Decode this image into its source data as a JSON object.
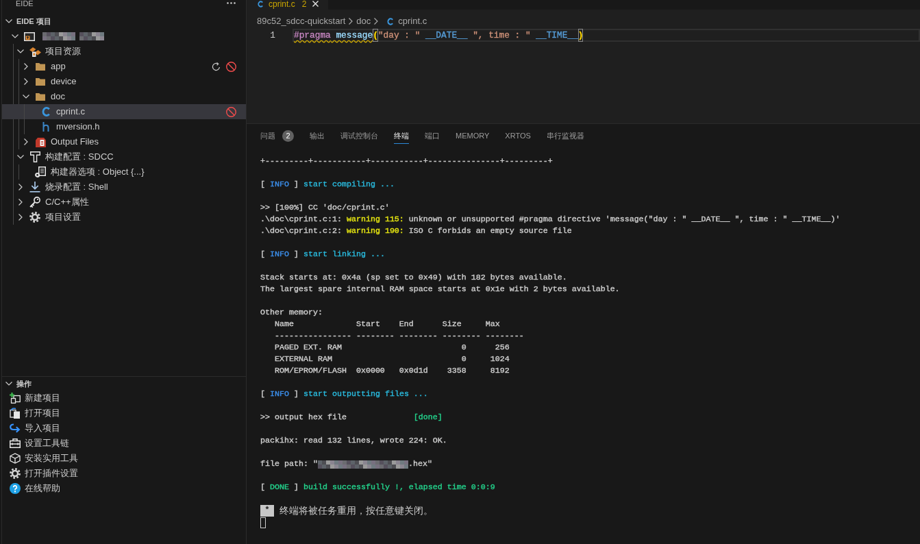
{
  "sidebar": {
    "header": {
      "title": "EIDE"
    },
    "project_section": {
      "title": "EIDE 项目",
      "expanded": true,
      "tree": [
        {
          "kind": "project",
          "redacted": true,
          "expanded": true,
          "selected": false,
          "children": [
            {
              "kind": "sources",
              "label": "项目资源",
              "expanded": true,
              "selected": false,
              "children": [
                {
                  "kind": "folder",
                  "label": "app",
                  "expanded": false,
                  "selected": false,
                  "actions": [
                    {
                      "kind": "refresh"
                    },
                    {
                      "kind": "exclude"
                    }
                  ]
                },
                {
                  "kind": "folder",
                  "label": "device",
                  "expanded": false,
                  "selected": false
                },
                {
                  "kind": "folder",
                  "label": "doc",
                  "expanded": true,
                  "selected": false,
                  "children": [
                    {
                      "kind": "c-file",
                      "label": "cprint.c",
                      "selected": true,
                      "actions": [
                        {
                          "kind": "exclude"
                        }
                      ]
                    },
                    {
                      "kind": "h-file",
                      "label": "mversion.h",
                      "selected": false
                    }
                  ]
                },
                {
                  "kind": "output",
                  "label": "Output Files",
                  "expanded": false,
                  "selected": false
                }
              ]
            },
            {
              "kind": "build",
              "label": "构建配置 : SDCC",
              "expanded": true,
              "selected": false,
              "children": [
                {
                  "kind": "builder-options",
                  "label": "构建器选项 : Object {...}",
                  "selected": false
                }
              ]
            },
            {
              "kind": "flash",
              "label": "烧录配置 : Shell",
              "expanded": false,
              "selected": false
            },
            {
              "kind": "properties",
              "label": "C/C++属性",
              "expanded": false,
              "selected": false
            },
            {
              "kind": "settings",
              "label": "项目设置",
              "expanded": false,
              "selected": false
            }
          ]
        }
      ]
    },
    "operations": {
      "title": "操作",
      "expanded": true,
      "items": [
        {
          "kind": "new-project",
          "label": "新建项目"
        },
        {
          "kind": "open-project",
          "label": "打开项目"
        },
        {
          "kind": "import-project",
          "label": "导入项目"
        },
        {
          "kind": "toolchain",
          "label": "设置工具链"
        },
        {
          "kind": "utility",
          "label": "安装实用工具"
        },
        {
          "kind": "plugin-settings",
          "label": "打开插件设置"
        },
        {
          "kind": "help",
          "label": "在线帮助"
        }
      ]
    }
  },
  "editor": {
    "tabs": [
      {
        "kind": "c-file",
        "label": "cprint.c",
        "problems": "2",
        "selected": true
      }
    ],
    "breadcrumb": [
      {
        "kind": "folder",
        "label": "89c52_sdcc-quickstart"
      },
      {
        "kind": "folder",
        "label": "doc"
      },
      {
        "kind": "c-file",
        "label": "cprint.c"
      }
    ],
    "lines": [
      {
        "number": "1",
        "current": true,
        "tokens": [
          {
            "text": "#pragma",
            "color": "#c586c0",
            "squiggle": true,
            "matched": false
          },
          {
            "text": " message",
            "color": "#9cdcfe",
            "squiggle": true,
            "matched": false
          },
          {
            "text": "(",
            "color": "#ffd700",
            "squiggle": false,
            "matched": true
          },
          {
            "text": "\"day : \"",
            "color": "#ce9178",
            "squiggle": false,
            "matched": false
          },
          {
            "text": " __DATE__ ",
            "color": "#569cd6",
            "squiggle": false,
            "matched": false
          },
          {
            "text": "\", time : \"",
            "color": "#ce9178",
            "squiggle": false,
            "matched": false
          },
          {
            "text": " __TIME__",
            "color": "#569cd6",
            "squiggle": false,
            "matched": false
          },
          {
            "text": ")",
            "color": "#ffd700",
            "squiggle": false,
            "matched": true
          }
        ]
      }
    ]
  },
  "panel": {
    "tabs": [
      {
        "label": "问题",
        "badge": "2",
        "selected": false
      },
      {
        "label": "输出",
        "selected": false
      },
      {
        "label": "调试控制台",
        "selected": false
      },
      {
        "label": "终端",
        "selected": true
      },
      {
        "label": "端口",
        "selected": false
      },
      {
        "label": "MEMORY",
        "selected": false
      },
      {
        "label": "XRTOS",
        "selected": false
      },
      {
        "label": "串行监视器",
        "selected": false
      }
    ],
    "terminal": {
      "blocks": [
        [
          {
            "kind": "output",
            "segments": [
              {
                "kind": "text",
                "text": "+---------+-----------+-----------+---------------+---------+",
                "color": "#cccccc"
              }
            ]
          }
        ],
        [
          {
            "kind": "output",
            "segments": [
              {
                "kind": "text",
                "text": "[ ",
                "color": "#cccccc"
              },
              {
                "kind": "text",
                "text": "INFO",
                "color": "#3b8eea"
              },
              {
                "kind": "text",
                "text": " ] ",
                "color": "#cccccc"
              },
              {
                "kind": "text",
                "text": "start compiling ...",
                "color": "#29b8db"
              }
            ]
          }
        ],
        [
          {
            "kind": "output",
            "segments": [
              {
                "kind": "text",
                "text": ">> [100%] CC 'doc/cprint.c'",
                "color": "#cccccc"
              }
            ]
          },
          {
            "kind": "output",
            "segments": [
              {
                "kind": "text",
                "text": ".\\doc\\cprint.c:1: ",
                "color": "#cccccc"
              },
              {
                "kind": "text",
                "text": "warning 115:",
                "color": "#e5e510"
              },
              {
                "kind": "text",
                "text": " unknown or unsupported #pragma directive 'message(\"day : \" __DATE__ \", time : \" __TIME__)'",
                "color": "#cccccc"
              }
            ]
          },
          {
            "kind": "output",
            "segments": [
              {
                "kind": "text",
                "text": ".\\doc\\cprint.c:2: ",
                "color": "#cccccc"
              },
              {
                "kind": "text",
                "text": "warning 190:",
                "color": "#e5e510"
              },
              {
                "kind": "text",
                "text": " ISO C forbids an empty source file",
                "color": "#cccccc"
              }
            ]
          }
        ],
        [
          {
            "kind": "output",
            "segments": [
              {
                "kind": "text",
                "text": "[ ",
                "color": "#cccccc"
              },
              {
                "kind": "text",
                "text": "INFO",
                "color": "#3b8eea"
              },
              {
                "kind": "text",
                "text": " ] ",
                "color": "#cccccc"
              },
              {
                "kind": "text",
                "text": "start linking ...",
                "color": "#29b8db"
              }
            ]
          }
        ],
        [
          {
            "kind": "output",
            "segments": [
              {
                "kind": "text",
                "text": "Stack starts at: 0x4a (sp set to 0x49) with 182 bytes available.",
                "color": "#cccccc"
              }
            ]
          },
          {
            "kind": "output",
            "segments": [
              {
                "kind": "text",
                "text": "The largest spare internal RAM space starts at 0x1e with 2 bytes available.",
                "color": "#cccccc"
              }
            ]
          }
        ],
        [
          {
            "kind": "output",
            "segments": [
              {
                "kind": "text",
                "text": "Other memory:",
                "color": "#cccccc"
              }
            ]
          },
          {
            "kind": "output",
            "segments": [
              {
                "kind": "text",
                "text": "   Name             Start    End      Size     Max",
                "color": "#cccccc"
              }
            ]
          },
          {
            "kind": "output",
            "segments": [
              {
                "kind": "text",
                "text": "   ---------------- -------- -------- -------- --------",
                "color": "#cccccc"
              }
            ]
          },
          {
            "kind": "output",
            "segments": [
              {
                "kind": "text",
                "text": "   PAGED EXT. RAM                         0      256",
                "color": "#cccccc"
              }
            ]
          },
          {
            "kind": "output",
            "segments": [
              {
                "kind": "text",
                "text": "   EXTERNAL RAM                           0     1024",
                "color": "#cccccc"
              }
            ]
          },
          {
            "kind": "output",
            "segments": [
              {
                "kind": "text",
                "text": "   ROM/EPROM/FLASH  0x0000   0x0d1d    3358     8192",
                "color": "#cccccc"
              }
            ]
          }
        ],
        [
          {
            "kind": "output",
            "segments": [
              {
                "kind": "text",
                "text": "[ ",
                "color": "#cccccc"
              },
              {
                "kind": "text",
                "text": "INFO",
                "color": "#3b8eea"
              },
              {
                "kind": "text",
                "text": " ] ",
                "color": "#cccccc"
              },
              {
                "kind": "text",
                "text": "start outputting files ...",
                "color": "#29b8db"
              }
            ]
          }
        ],
        [
          {
            "kind": "output",
            "segments": [
              {
                "kind": "text",
                "text": ">> output hex file              ",
                "color": "#cccccc"
              },
              {
                "kind": "text",
                "text": "[done]",
                "color": "#23d18b"
              }
            ]
          }
        ],
        [
          {
            "kind": "output",
            "segments": [
              {
                "kind": "text",
                "text": "packihx: read 132 lines, wrote 224: OK.",
                "color": "#cccccc"
              }
            ]
          }
        ],
        [
          {
            "kind": "output",
            "segments": [
              {
                "kind": "text",
                "text": "file path: \"",
                "color": "#cccccc"
              },
              {
                "kind": "redacted"
              },
              {
                "kind": "text",
                "text": ".hex\"",
                "color": "#cccccc"
              }
            ]
          }
        ],
        [
          {
            "kind": "output",
            "segments": [
              {
                "kind": "text",
                "text": "[ ",
                "color": "#cccccc"
              },
              {
                "kind": "text",
                "text": "DONE",
                "color": "#23d18b"
              },
              {
                "kind": "text",
                "text": " ] ",
                "color": "#cccccc"
              },
              {
                "kind": "text",
                "text": "build successfully !, elapsed time 0:0:9",
                "color": "#23d18b"
              }
            ]
          }
        ],
        [
          {
            "kind": "notice",
            "marker": "*",
            "text": "终端将被任务重用，按任意键关闭。"
          },
          {
            "kind": "cursor"
          }
        ]
      ]
    }
  }
}
